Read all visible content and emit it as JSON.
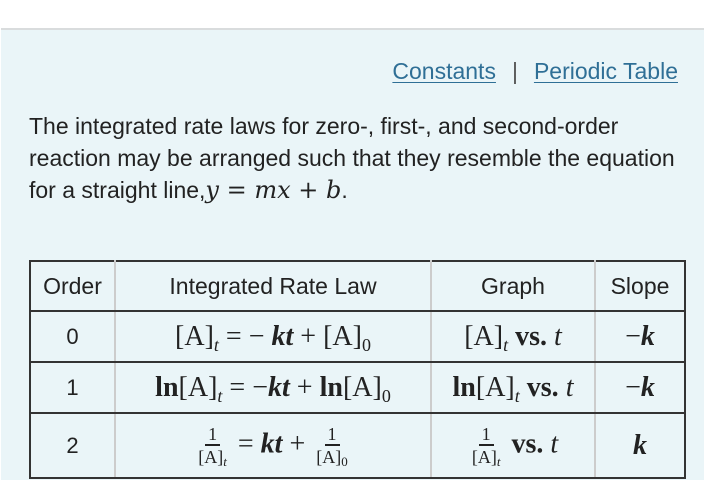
{
  "links": {
    "constants": "Constants",
    "separator": "|",
    "periodic_table": "Periodic Table"
  },
  "intro": {
    "text": "The integrated rate laws for zero-, first-, and second-order reaction may be arranged such that they resemble the equation for a straight line,",
    "equation": "y = mx + b",
    "end": "."
  },
  "table": {
    "headers": [
      "Order",
      "Integrated Rate Law",
      "Graph",
      "Slope"
    ],
    "rows": [
      {
        "order": "0",
        "law": "[A]_t = − kt + [A]_0",
        "graph": "[A]_t vs. t",
        "slope": "−k"
      },
      {
        "order": "1",
        "law": "ln[A]_t = −kt + ln[A]_0",
        "graph": "ln[A]_t vs. t",
        "slope": "−k"
      },
      {
        "order": "2",
        "law": "1/[A]_t = kt + 1/[A]_0",
        "graph": "1/[A]_t vs. t",
        "slope": "k"
      }
    ]
  },
  "tokens": {
    "A": "[A]",
    "t": "t",
    "zero": "0",
    "one": "1",
    "ln": "ln",
    "vs": "vs.",
    "k": "k",
    "kt": "kt",
    "eq": " = ",
    "plus": " + ",
    "minus": "−",
    "minus_sp": "− ",
    "y": "y",
    "m": "m",
    "x": "x",
    "b": "b"
  }
}
